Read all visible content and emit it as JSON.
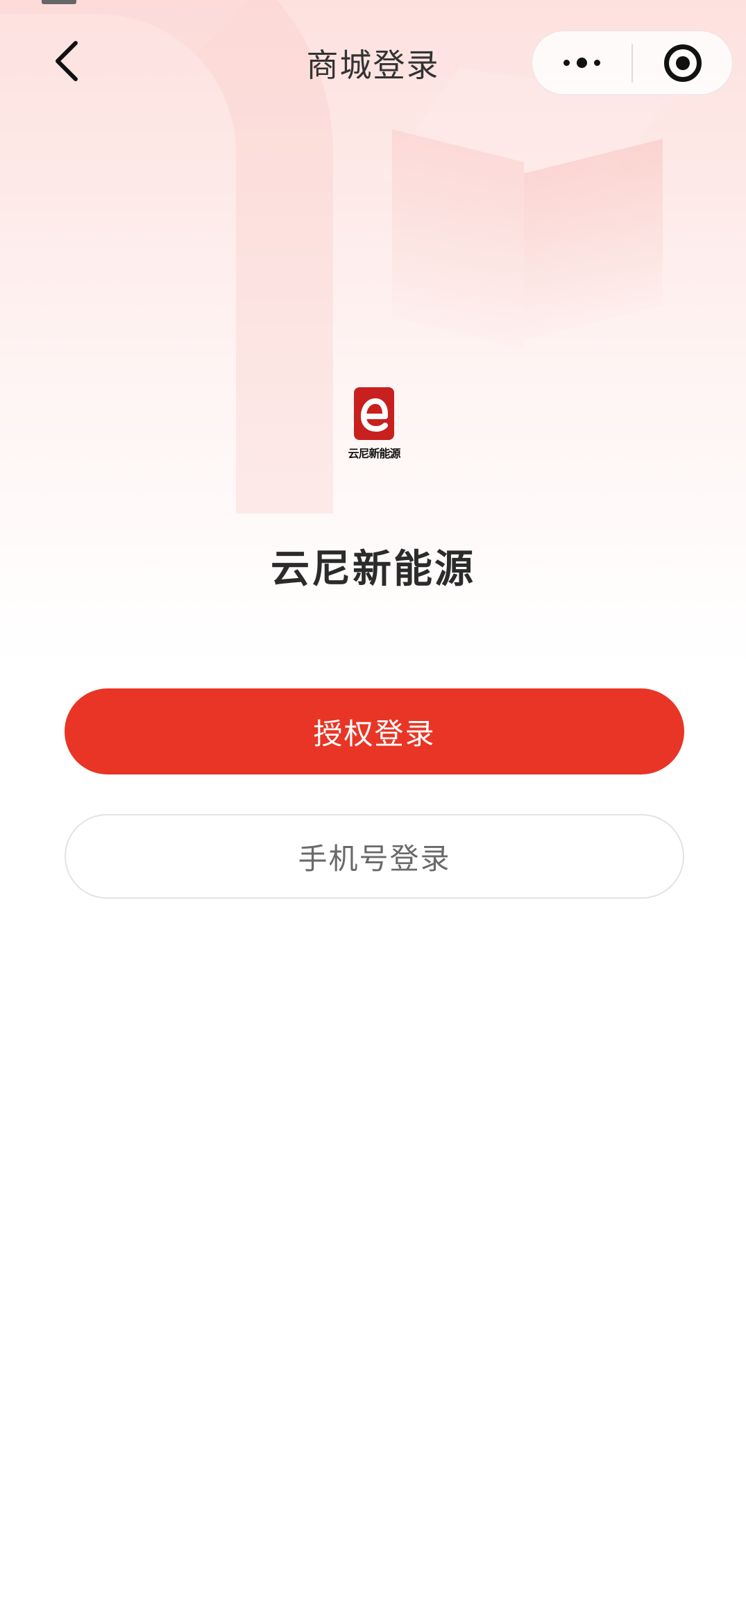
{
  "nav": {
    "title": "商城登录",
    "back_icon": "chevron-left-icon",
    "more_icon": "more-dots-icon",
    "close_icon": "target-circle-icon"
  },
  "brand": {
    "logo_caption": "云尼新能源",
    "name": "云尼新能源",
    "logo_color": "#c8201e"
  },
  "actions": {
    "authorize_login": "授权登录",
    "phone_login": "手机号登录"
  },
  "colors": {
    "primary": "#e83525",
    "title_text": "#333333"
  }
}
